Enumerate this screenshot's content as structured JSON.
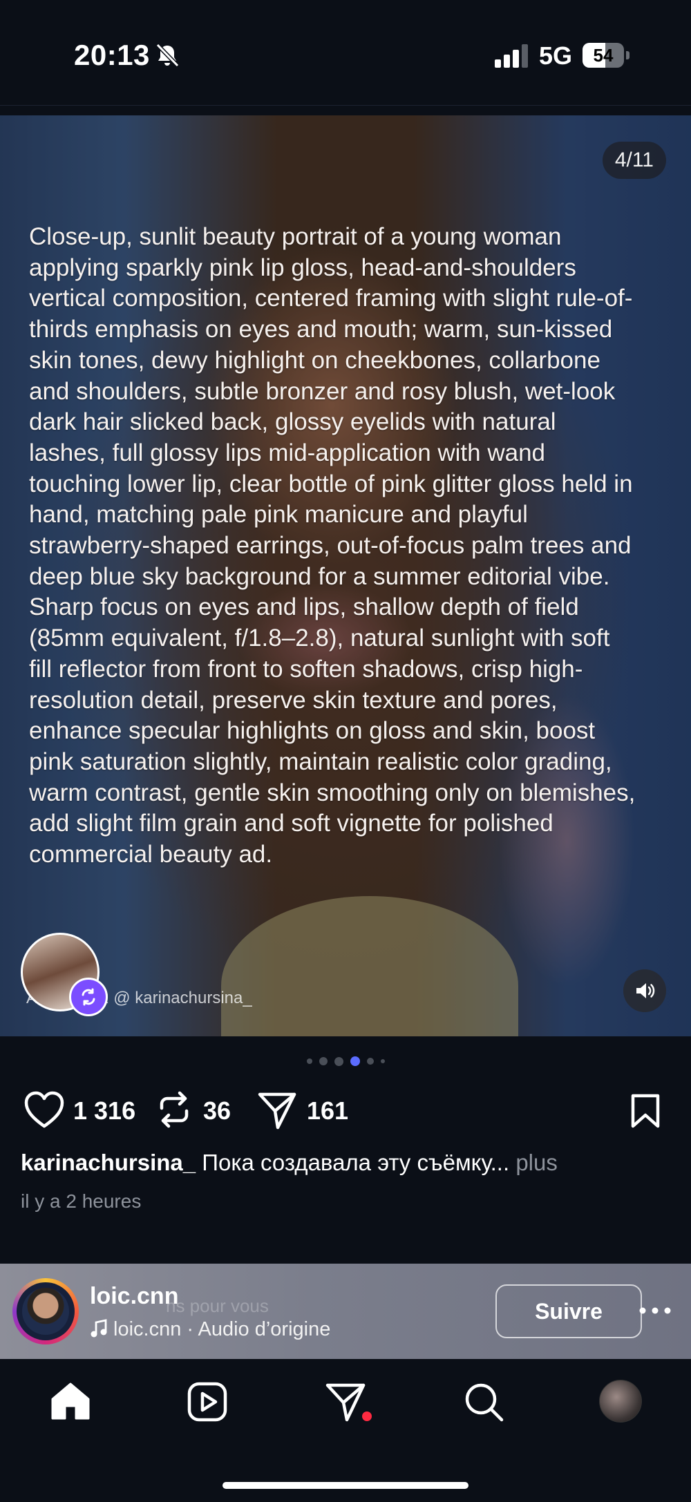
{
  "status_bar": {
    "time": "20:13",
    "network": "5G",
    "battery": "54",
    "icons": [
      "bell-slash-icon",
      "signal-icon",
      "battery-icon"
    ]
  },
  "post": {
    "counter": "4/11",
    "prompt_text": "Close-up, sunlit beauty portrait of a young woman applying sparkly pink lip gloss, head-and-shoulders vertical composition, centered framing with slight rule-of-thirds emphasis on eyes and mouth; warm, sun-kissed skin tones, dewy highlight on cheekbones, collarbone and shoulders, subtle bronzer and rosy blush, wet-look dark hair slicked back, glossy eyelids with natural lashes, full glossy lips mid-application with wand touching lower lip, clear bottle of pink glitter gloss held in hand, matching pale pink manicure and playful strawberry-shaped earrings, out-of-focus palm trees and deep blue sky background for a summer editorial vibe. Sharp focus on eyes and lips, shallow depth of field (85mm equivalent, f/1.8–2.8), natural sunlight with soft fill reflector from front to soften shadows, crisp high-resolution detail, preserve skin texture and pores, enhance specular highlights on gloss and skin, boost pink saturation slightly, maintain realistic color grading, warm contrast, gentle skin smoothing only on blemishes, add slight film grain and soft vignette for polished commercial beauty ad.",
    "credit": "AI EDITOR @ karinachursina_",
    "carousel_active_index": 3,
    "carousel_dot_count": 6,
    "likes": "1 316",
    "reposts": "36",
    "shares": "161",
    "caption_user": "karinachursina_",
    "caption_text": " Пока создавала эту съёмку...",
    "caption_more": " plus",
    "time_ago": "il y a 2 heures"
  },
  "suggestion": {
    "ghost_text": "ns pour vous",
    "username": "loic.cnn",
    "audio": "loic.cnn · Audio d’origine",
    "follow_label": "Suivre"
  },
  "tabbar": {
    "items": [
      "home-icon",
      "reels-icon",
      "direct-icon",
      "search-icon",
      "profile-avatar"
    ]
  },
  "colors": {
    "background": "#0b0f17",
    "active_dot": "#5b6cff",
    "remix_badge": "#7b4dff",
    "notification": "#ff2a41"
  }
}
